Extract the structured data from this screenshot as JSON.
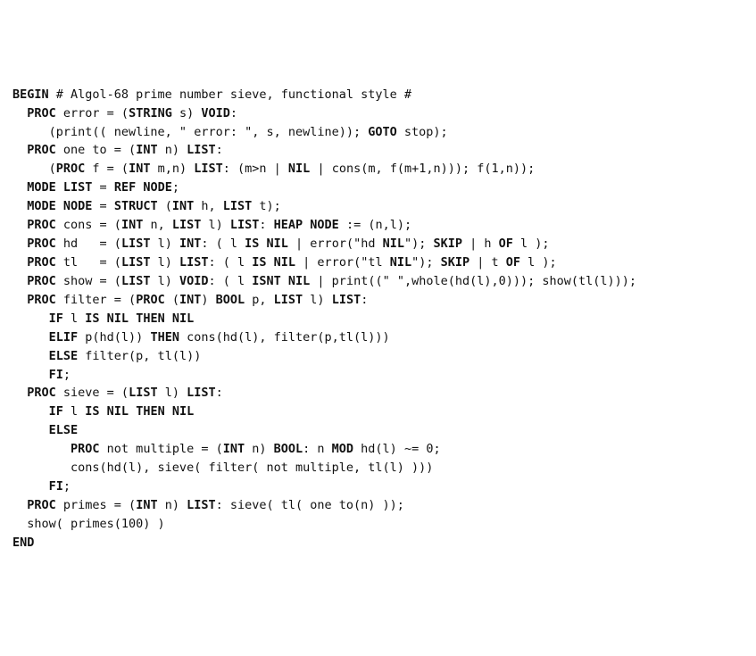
{
  "code": {
    "tokens": [
      [
        [
          "k",
          "BEGIN"
        ],
        [
          "p",
          " # Algol-68 prime number sieve, functional style #"
        ]
      ],
      [
        [
          "p",
          ""
        ]
      ],
      [
        [
          "p",
          "  "
        ],
        [
          "k",
          "PROC"
        ],
        [
          "p",
          " error = ("
        ],
        [
          "k",
          "STRING"
        ],
        [
          "p",
          " s) "
        ],
        [
          "k",
          "VOID"
        ],
        [
          "p",
          ":"
        ]
      ],
      [
        [
          "p",
          "     (print(( newline, \" error: \", s, newline)); "
        ],
        [
          "k",
          "GOTO"
        ],
        [
          "p",
          " stop);"
        ]
      ],
      [
        [
          "p",
          "  "
        ],
        [
          "k",
          "PROC"
        ],
        [
          "p",
          " one to = ("
        ],
        [
          "k",
          "INT"
        ],
        [
          "p",
          " n) "
        ],
        [
          "k",
          "LIST"
        ],
        [
          "p",
          ":"
        ]
      ],
      [
        [
          "p",
          "     ("
        ],
        [
          "k",
          "PROC"
        ],
        [
          "p",
          " f = ("
        ],
        [
          "k",
          "INT"
        ],
        [
          "p",
          " m,n) "
        ],
        [
          "k",
          "LIST"
        ],
        [
          "p",
          ": (m>n | "
        ],
        [
          "k",
          "NIL"
        ],
        [
          "p",
          " | cons(m, f(m+1,n))); f(1,n));"
        ]
      ],
      [
        [
          "p",
          ""
        ]
      ],
      [
        [
          "p",
          "  "
        ],
        [
          "k",
          "MODE LIST"
        ],
        [
          "p",
          " = "
        ],
        [
          "k",
          "REF NODE"
        ],
        [
          "p",
          ";"
        ]
      ],
      [
        [
          "p",
          "  "
        ],
        [
          "k",
          "MODE NODE"
        ],
        [
          "p",
          " = "
        ],
        [
          "k",
          "STRUCT"
        ],
        [
          "p",
          " ("
        ],
        [
          "k",
          "INT"
        ],
        [
          "p",
          " h, "
        ],
        [
          "k",
          "LIST"
        ],
        [
          "p",
          " t);"
        ]
      ],
      [
        [
          "p",
          "  "
        ],
        [
          "k",
          "PROC"
        ],
        [
          "p",
          " cons = ("
        ],
        [
          "k",
          "INT"
        ],
        [
          "p",
          " n, "
        ],
        [
          "k",
          "LIST"
        ],
        [
          "p",
          " l) "
        ],
        [
          "k",
          "LIST"
        ],
        [
          "p",
          ": "
        ],
        [
          "k",
          "HEAP NODE"
        ],
        [
          "p",
          " := (n,l);"
        ]
      ],
      [
        [
          "p",
          "  "
        ],
        [
          "k",
          "PROC"
        ],
        [
          "p",
          " hd   = ("
        ],
        [
          "k",
          "LIST"
        ],
        [
          "p",
          " l) "
        ],
        [
          "k",
          "INT"
        ],
        [
          "p",
          ": ( l "
        ],
        [
          "k",
          "IS NIL"
        ],
        [
          "p",
          " | error(\"hd "
        ],
        [
          "k",
          "NIL"
        ],
        [
          "p",
          "\"); "
        ],
        [
          "k",
          "SKIP"
        ],
        [
          "p",
          " | h "
        ],
        [
          "k",
          "OF"
        ],
        [
          "p",
          " l );"
        ]
      ],
      [
        [
          "p",
          "  "
        ],
        [
          "k",
          "PROC"
        ],
        [
          "p",
          " tl   = ("
        ],
        [
          "k",
          "LIST"
        ],
        [
          "p",
          " l) "
        ],
        [
          "k",
          "LIST"
        ],
        [
          "p",
          ": ( l "
        ],
        [
          "k",
          "IS NIL"
        ],
        [
          "p",
          " | error(\"tl "
        ],
        [
          "k",
          "NIL"
        ],
        [
          "p",
          "\"); "
        ],
        [
          "k",
          "SKIP"
        ],
        [
          "p",
          " | t "
        ],
        [
          "k",
          "OF"
        ],
        [
          "p",
          " l );"
        ]
      ],
      [
        [
          "p",
          "  "
        ],
        [
          "k",
          "PROC"
        ],
        [
          "p",
          " show = ("
        ],
        [
          "k",
          "LIST"
        ],
        [
          "p",
          " l) "
        ],
        [
          "k",
          "VOID"
        ],
        [
          "p",
          ": ( l "
        ],
        [
          "k",
          "ISNT NIL"
        ],
        [
          "p",
          " | print((\" \",whole(hd(l),0))); show(tl(l)));"
        ]
      ],
      [
        [
          "p",
          ""
        ]
      ],
      [
        [
          "p",
          "  "
        ],
        [
          "k",
          "PROC"
        ],
        [
          "p",
          " filter = ("
        ],
        [
          "k",
          "PROC"
        ],
        [
          "p",
          " ("
        ],
        [
          "k",
          "INT"
        ],
        [
          "p",
          ") "
        ],
        [
          "k",
          "BOOL"
        ],
        [
          "p",
          " p, "
        ],
        [
          "k",
          "LIST"
        ],
        [
          "p",
          " l) "
        ],
        [
          "k",
          "LIST"
        ],
        [
          "p",
          ":"
        ]
      ],
      [
        [
          "p",
          "     "
        ],
        [
          "k",
          "IF"
        ],
        [
          "p",
          " l "
        ],
        [
          "k",
          "IS NIL THEN NIL"
        ]
      ],
      [
        [
          "p",
          "     "
        ],
        [
          "k",
          "ELIF"
        ],
        [
          "p",
          " p(hd(l)) "
        ],
        [
          "k",
          "THEN"
        ],
        [
          "p",
          " cons(hd(l), filter(p,tl(l)))"
        ]
      ],
      [
        [
          "p",
          "     "
        ],
        [
          "k",
          "ELSE"
        ],
        [
          "p",
          " filter(p, tl(l))"
        ]
      ],
      [
        [
          "p",
          "     "
        ],
        [
          "k",
          "FI"
        ],
        [
          "p",
          ";"
        ]
      ],
      [
        [
          "p",
          ""
        ]
      ],
      [
        [
          "p",
          "  "
        ],
        [
          "k",
          "PROC"
        ],
        [
          "p",
          " sieve = ("
        ],
        [
          "k",
          "LIST"
        ],
        [
          "p",
          " l) "
        ],
        [
          "k",
          "LIST"
        ],
        [
          "p",
          ":"
        ]
      ],
      [
        [
          "p",
          "     "
        ],
        [
          "k",
          "IF"
        ],
        [
          "p",
          " l "
        ],
        [
          "k",
          "IS NIL THEN NIL"
        ]
      ],
      [
        [
          "p",
          "     "
        ],
        [
          "k",
          "ELSE"
        ]
      ],
      [
        [
          "p",
          "        "
        ],
        [
          "k",
          "PROC"
        ],
        [
          "p",
          " not multiple = ("
        ],
        [
          "k",
          "INT"
        ],
        [
          "p",
          " n) "
        ],
        [
          "k",
          "BOOL"
        ],
        [
          "p",
          ": n "
        ],
        [
          "k",
          "MOD"
        ],
        [
          "p",
          " hd(l) ~= 0;"
        ]
      ],
      [
        [
          "p",
          "        cons(hd(l), sieve( filter( not multiple, tl(l) )))"
        ]
      ],
      [
        [
          "p",
          "     "
        ],
        [
          "k",
          "FI"
        ],
        [
          "p",
          ";"
        ]
      ],
      [
        [
          "p",
          ""
        ]
      ],
      [
        [
          "p",
          "  "
        ],
        [
          "k",
          "PROC"
        ],
        [
          "p",
          " primes = ("
        ],
        [
          "k",
          "INT"
        ],
        [
          "p",
          " n) "
        ],
        [
          "k",
          "LIST"
        ],
        [
          "p",
          ": sieve( tl( one to(n) ));"
        ]
      ],
      [
        [
          "p",
          ""
        ]
      ],
      [
        [
          "p",
          "  show( primes(100) )"
        ]
      ],
      [
        [
          "k",
          "END"
        ]
      ]
    ]
  }
}
